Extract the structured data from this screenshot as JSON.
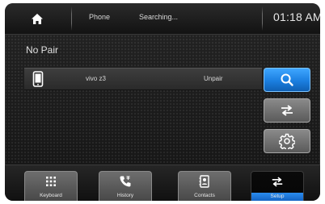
{
  "status_bar": {
    "phone_label": "Phone",
    "status_text": "Searching...",
    "time": "01:18 AM",
    "home_icon": "home-icon"
  },
  "pairing": {
    "status": "No Pair",
    "devices": [
      {
        "name": "vivo z3",
        "action_label": "Unpair",
        "icon": "smartphone-icon"
      }
    ]
  },
  "side_buttons": {
    "search_icon": "search-icon",
    "swap_icon": "swap-arrows-icon",
    "settings_icon": "gear-icon"
  },
  "bottom_nav": {
    "items": [
      {
        "label": "Keyboard",
        "icon": "keypad-icon"
      },
      {
        "label": "History",
        "icon": "phone-log-icon"
      },
      {
        "label": "Contacts",
        "icon": "contacts-icon"
      },
      {
        "label": "Setup",
        "icon": "swap-arrows-icon",
        "active": true
      }
    ]
  },
  "colors": {
    "accent_blue": "#1b7fe0",
    "background": "#1b1b1b",
    "text": "#e0e0e0"
  }
}
